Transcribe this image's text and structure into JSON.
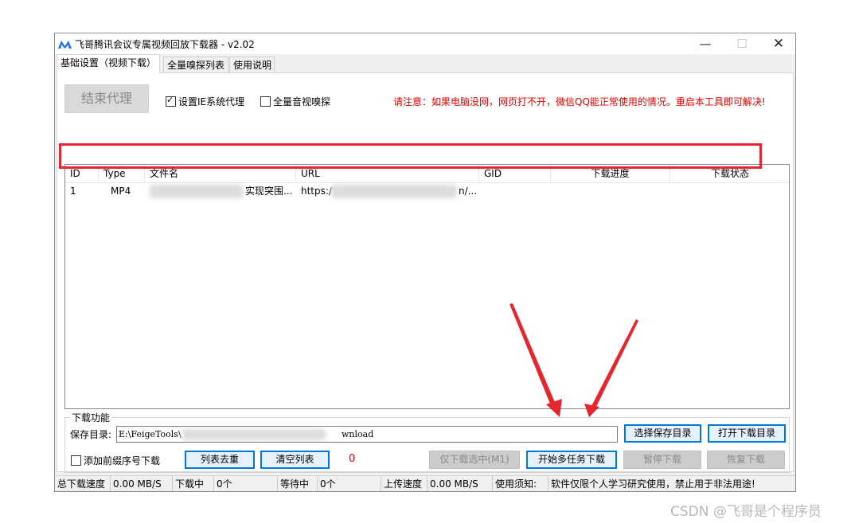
{
  "window": {
    "title": "飞哥腾讯会议专属视频回放下载器 - v2.02",
    "controls": {
      "minimize": "—",
      "maximize": "☐",
      "close": "✕"
    }
  },
  "tabs": [
    {
      "label": "基础设置（视频下载）",
      "active": true
    },
    {
      "label": "全量嗅探列表",
      "active": false
    },
    {
      "label": "使用说明",
      "active": false
    }
  ],
  "top": {
    "end_proxy_button": "结束代理",
    "set_ie_proxy": {
      "label": "设置IE系统代理",
      "checked": true
    },
    "full_sniff": {
      "label": "全量音视嗅探",
      "checked": false
    },
    "notice": "请注意：如果电脑没网，网页打不开，微信QQ能正常使用的情况。重启本工具即可解决!"
  },
  "table": {
    "columns": [
      "ID",
      "Type",
      "文件名",
      "URL",
      "GID",
      "下载进度",
      "下载状态"
    ],
    "rows": [
      {
        "id": "1",
        "type": "MP4",
        "filename": "实现突围...",
        "url_prefix": "https:/",
        "url_suffix": "n/...",
        "gid": "",
        "progress": "",
        "status": ""
      }
    ]
  },
  "download": {
    "legend": "下载功能",
    "save_dir_label": "保存目录:",
    "save_dir_prefix": "E:\\FeigeTools\\",
    "save_dir_suffix": "wnload",
    "choose_dir_button": "选择保存目录",
    "open_dir_button": "打开下载目录",
    "prefix_checkbox": {
      "label": "添加前缀序号下载",
      "checked": false
    },
    "dedupe_button": "列表去重",
    "clear_button": "清空列表",
    "count": "0",
    "download_selected_button": "仅下载选中(M1)",
    "start_multi_button": "开始多任务下载",
    "pause_button": "暂停下载",
    "resume_button": "恢复下载"
  },
  "statusbar": {
    "total_speed_label": "总下载速度",
    "total_speed_value": "0.00 MB/S",
    "downloading_label": "下载中",
    "downloading_value": "0个",
    "waiting_label": "等待中",
    "waiting_value": "0个",
    "upload_label": "上传速度",
    "upload_value": "0.00 MB/S",
    "notice_label": "使用须知:",
    "notice_value": "软件仅限个人学习研究使用，禁止用于非法用途!"
  },
  "watermark": "CSDN @飞哥是个程序员",
  "colors": {
    "accent": "#0078d7",
    "warning": "#e00000",
    "highlight": "#e5262e"
  }
}
